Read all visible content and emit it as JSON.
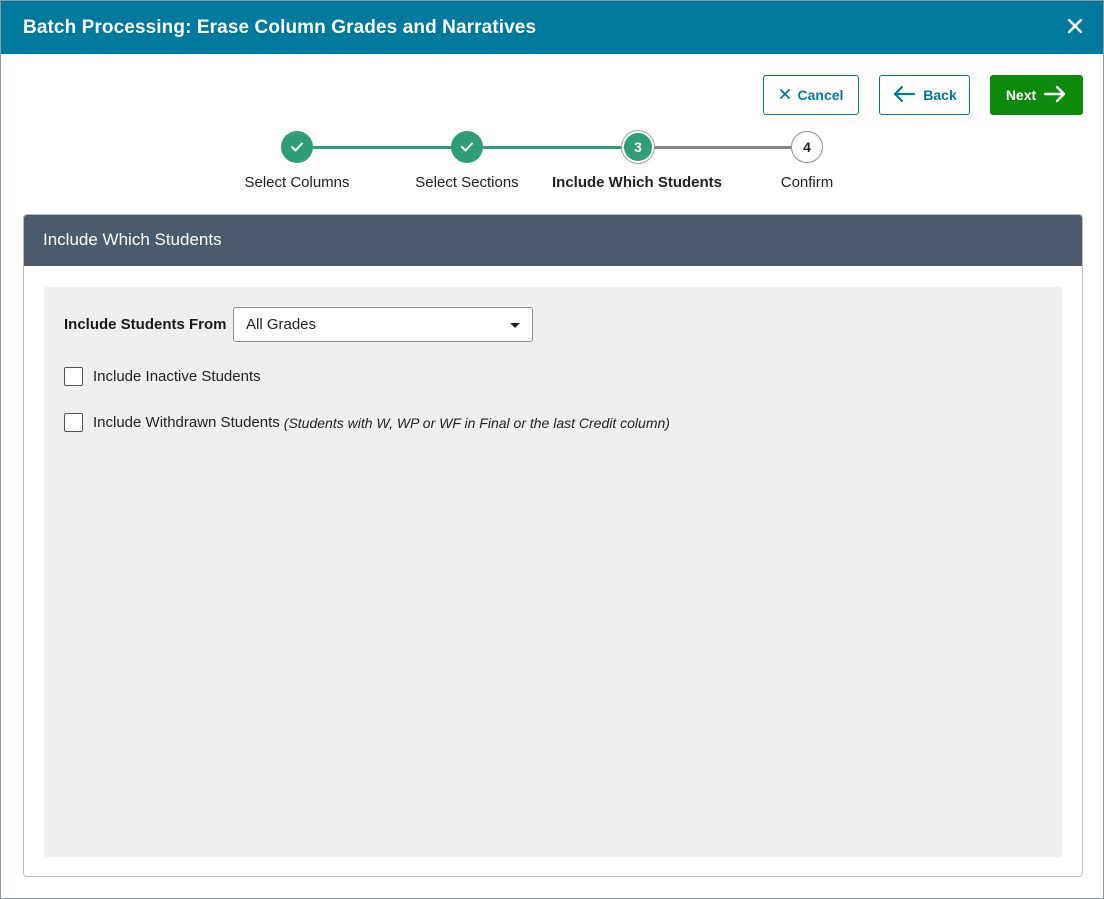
{
  "dialog": {
    "title": "Batch Processing: Erase Column Grades and Narratives",
    "close_icon": "close-icon"
  },
  "actions": {
    "cancel_label": "Cancel",
    "back_label": "Back",
    "next_label": "Next",
    "accent_color": "#00799e",
    "next_color": "#0c8a0c"
  },
  "stepper": {
    "steps": [
      {
        "label": "Select Columns",
        "number": "1",
        "state": "complete"
      },
      {
        "label": "Select Sections",
        "number": "2",
        "state": "complete"
      },
      {
        "label": "Include Which Students",
        "number": "3",
        "state": "current"
      },
      {
        "label": "Confirm",
        "number": "4",
        "state": "upcoming"
      }
    ],
    "complete_color": "#2f9e78"
  },
  "panel": {
    "title": "Include Which Students",
    "include_from_label": "Include Students From",
    "include_from_value": "All Grades",
    "inactive_label": "Include Inactive Students",
    "inactive_checked": false,
    "withdrawn_label": "Include Withdrawn Students",
    "withdrawn_note": "(Students with W, WP or WF in Final or the last Credit column)",
    "withdrawn_checked": false
  }
}
